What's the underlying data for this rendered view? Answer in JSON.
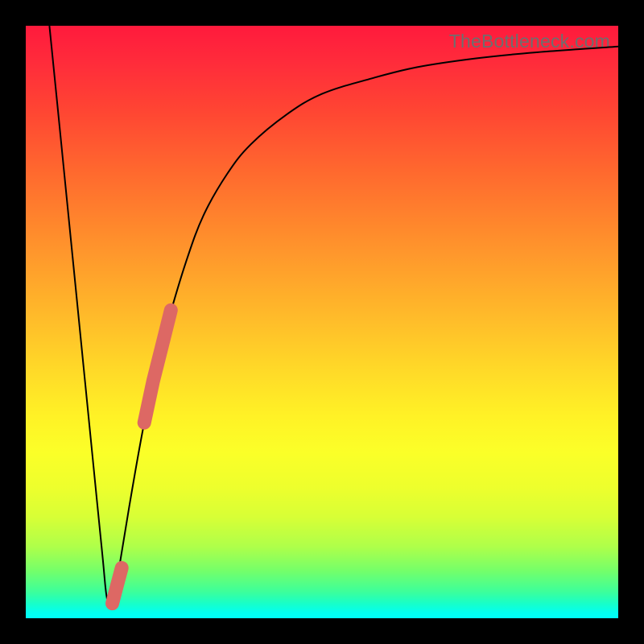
{
  "attribution": "TheBottleneck.com",
  "colors": {
    "highlight_stroke": "#dd6864",
    "curve_stroke": "#000000",
    "frame": "#000000"
  },
  "chart_data": {
    "type": "line",
    "title": "",
    "xlabel": "",
    "ylabel": "",
    "xlim": [
      0,
      100
    ],
    "ylim": [
      0,
      100
    ],
    "series": [
      {
        "name": "bottleneck-curve",
        "x": [
          4.0,
          6.0,
          8.0,
          10.0,
          12.0,
          13.0,
          13.6,
          14.2,
          15.0,
          16.0,
          18.0,
          20.0,
          22.0,
          24.0,
          27.0,
          30.0,
          34.0,
          38.0,
          44.0,
          50.0,
          58.0,
          66.0,
          76.0,
          86.0,
          100.0
        ],
        "y": [
          100.0,
          80.0,
          60.0,
          40.0,
          20.0,
          10.0,
          4.0,
          2.0,
          4.0,
          10.0,
          22.0,
          33.0,
          42.0,
          50.0,
          60.0,
          68.0,
          75.0,
          80.0,
          85.0,
          88.5,
          91.0,
          93.0,
          94.5,
          95.5,
          96.5
        ]
      },
      {
        "name": "highlight-upper",
        "x": [
          20.0,
          21.5,
          23.0,
          24.5
        ],
        "y": [
          33.0,
          40.0,
          46.0,
          52.0
        ]
      },
      {
        "name": "highlight-lower",
        "x": [
          14.6,
          15.4,
          16.2
        ],
        "y": [
          2.5,
          5.5,
          8.5
        ]
      }
    ],
    "annotations": []
  }
}
